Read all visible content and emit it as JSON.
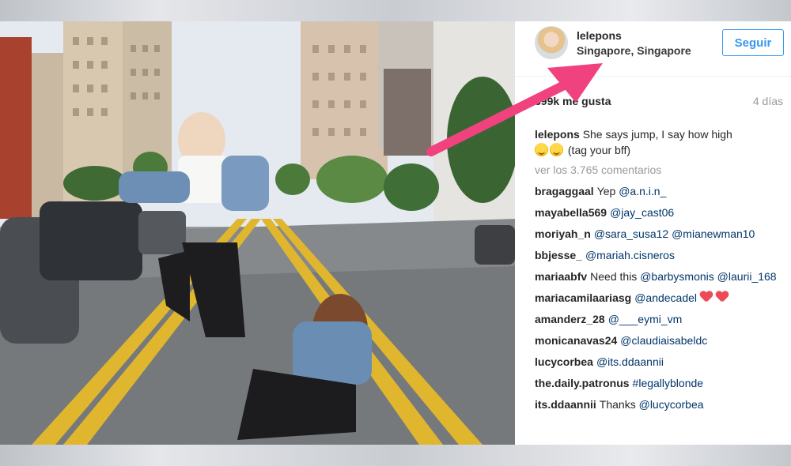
{
  "post": {
    "username": "lelepons",
    "location": "Singapore, Singapore",
    "follow_label": "Seguir",
    "likes": "399k me gusta",
    "time_ago": "4 días",
    "caption_user": "lelepons",
    "caption_text": "She says jump, I say how high",
    "caption_tail": "(tag your bff)",
    "view_all_comments": "ver los 3.765 comentarios"
  },
  "comments": [
    {
      "user": "bragaggaal",
      "text": "Yep ",
      "mention": "@a.n.i.n_"
    },
    {
      "user": "mayabella569",
      "text": "",
      "mention": "@jay_cast06"
    },
    {
      "user": "moriyah_n",
      "text": "",
      "mention": "@sara_susa12 @mianewman10"
    },
    {
      "user": "bbjesse_",
      "text": "",
      "mention": "@mariah.cisneros"
    },
    {
      "user": "mariaabfv",
      "text": "Need this ",
      "mention": "@barbysmonis @laurii_168"
    },
    {
      "user": "mariacamilaariasg",
      "text": "",
      "mention": "@andecadel"
    },
    {
      "user": "amanderz_28",
      "text": "",
      "mention": "@___eymi_vm"
    },
    {
      "user": "monicanavas24",
      "text": "",
      "mention": "@claudiaisabeldc"
    },
    {
      "user": "lucycorbea",
      "text": "",
      "mention": "@its.ddaannii"
    },
    {
      "user": "the.daily.patronus",
      "text": "",
      "mention": "#legallyblonde"
    },
    {
      "user": "its.ddaannii",
      "text": "Thanks ",
      "mention": "@lucycorbea"
    }
  ],
  "colors": {
    "accent": "#3897f0",
    "arrow": "#f0427f",
    "heart": "#ed4956",
    "mention": "#003569"
  },
  "icons": [
    "avatar",
    "face-laughing-icon",
    "face-tears-joy-icon",
    "heart-icon",
    "pink-arrow"
  ]
}
